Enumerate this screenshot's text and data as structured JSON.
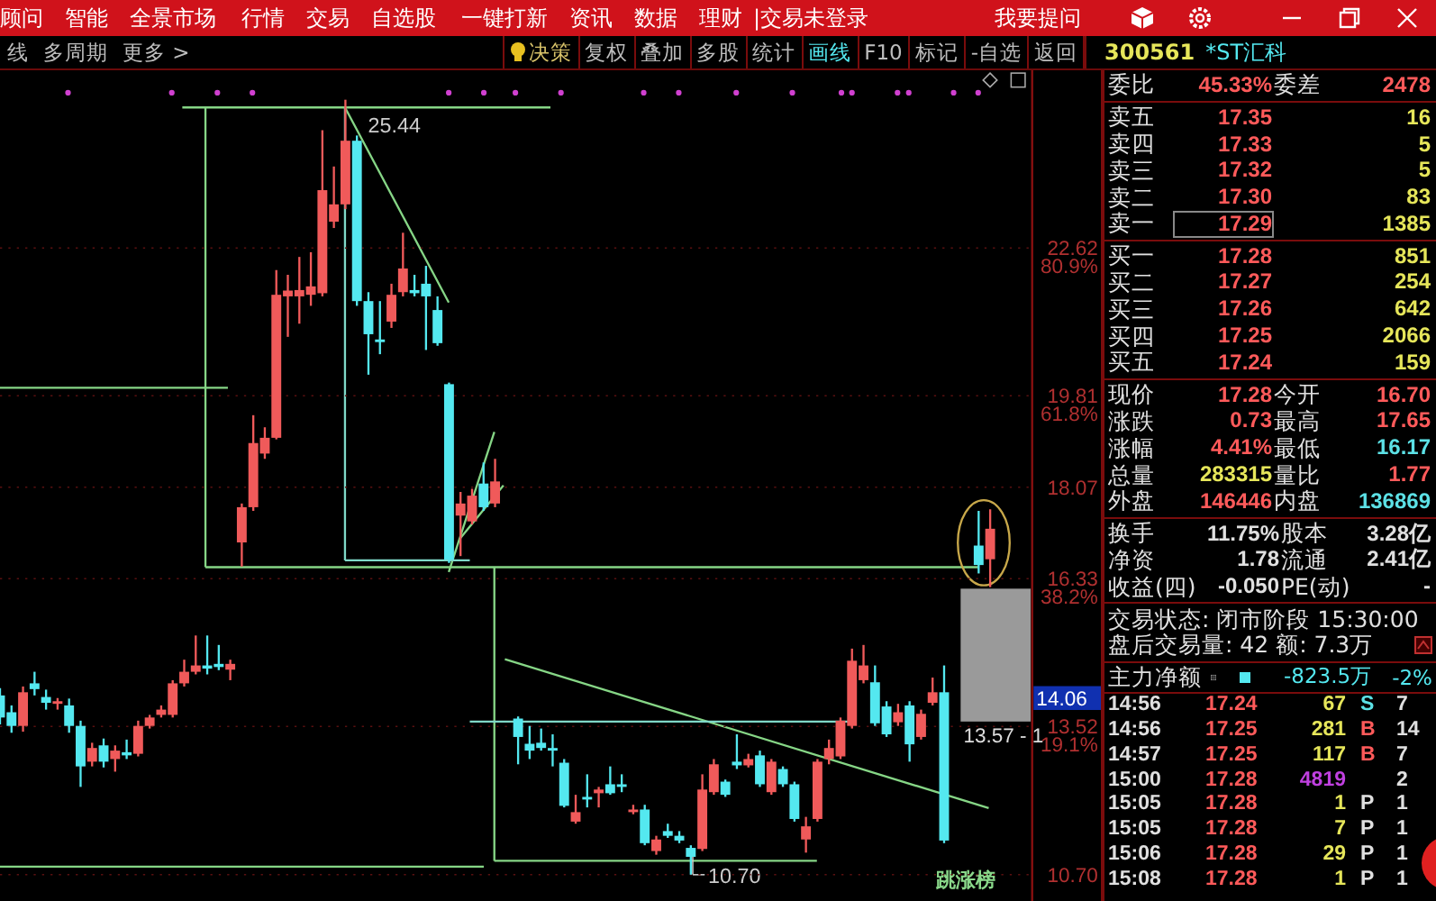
{
  "menu_bar": {
    "items": [
      "顾问",
      "智能",
      "全景市场",
      "行情",
      "交易",
      "自选股",
      "一键打新",
      "资讯",
      "数据",
      "理财"
    ],
    "login_status": "|交易未登录",
    "ask_link": "我要提问"
  },
  "toolbar": {
    "left": [
      "线",
      "多周期",
      "更多 >"
    ],
    "right": [
      {
        "label": "决策",
        "kind": "decision",
        "selected": false
      },
      {
        "label": "复权",
        "kind": "plain",
        "selected": false
      },
      {
        "label": "叠加",
        "kind": "plain",
        "selected": false
      },
      {
        "label": "多股",
        "kind": "plain",
        "selected": false
      },
      {
        "label": "统计",
        "kind": "plain",
        "selected": false
      },
      {
        "label": "画线",
        "kind": "plain",
        "selected": true
      },
      {
        "label": "F10",
        "kind": "plain",
        "selected": false
      },
      {
        "label": "标记",
        "kind": "plain",
        "selected": false
      },
      {
        "label": "-自选",
        "kind": "plain",
        "selected": false
      },
      {
        "label": "返回",
        "kind": "plain",
        "selected": false
      }
    ]
  },
  "stock": {
    "code": "300561",
    "name": "*ST汇科"
  },
  "chart": {
    "badge": "跳涨榜",
    "fib_ratios": [
      "80.9%",
      "61.8%",
      "38.2%",
      "19.1%"
    ],
    "low_label": "10.70",
    "chart_data": {
      "type": "candlestick",
      "categories": [
        null,
        null,
        null,
        null,
        null,
        null,
        null,
        null,
        null,
        null,
        null,
        null,
        null,
        null,
        null,
        null,
        null,
        null,
        null,
        null,
        null,
        null,
        null,
        null,
        null,
        null,
        null,
        null,
        null,
        null,
        null,
        null,
        null,
        null,
        null,
        null,
        null,
        null,
        null,
        null,
        null,
        null,
        null,
        null,
        null,
        null,
        null,
        null,
        null,
        null,
        null,
        null,
        null,
        null,
        null,
        null,
        null,
        null,
        null,
        null,
        null,
        null,
        null,
        null,
        null,
        null,
        null,
        null,
        null,
        null,
        null,
        null,
        null,
        null,
        null,
        null,
        null,
        null,
        null,
        null,
        null,
        null,
        null,
        null,
        null,
        null,
        null
      ],
      "ohlc": [
        [
          14.11,
          14.25,
          13.56,
          13.69
        ],
        [
          13.79,
          13.92,
          13.4,
          13.53
        ],
        [
          13.53,
          14.28,
          13.42,
          14.17
        ],
        [
          14.34,
          14.56,
          14.11,
          14.23
        ],
        [
          14.08,
          14.22,
          13.84,
          13.97
        ],
        [
          13.95,
          14.06,
          13.84,
          14.0
        ],
        [
          13.92,
          14.05,
          13.4,
          13.53
        ],
        [
          13.53,
          13.63,
          12.37,
          12.76
        ],
        [
          12.85,
          13.21,
          12.76,
          13.11
        ],
        [
          13.16,
          13.29,
          12.74,
          12.85
        ],
        [
          12.9,
          13.16,
          12.66,
          13.06
        ],
        [
          13.03,
          13.27,
          12.9,
          12.97
        ],
        [
          13.0,
          13.63,
          12.95,
          13.53
        ],
        [
          13.53,
          13.74,
          13.48,
          13.69
        ],
        [
          13.74,
          13.92,
          13.69,
          13.84
        ],
        [
          13.74,
          14.4,
          13.69,
          14.34
        ],
        [
          14.34,
          14.79,
          14.28,
          14.56
        ],
        [
          14.56,
          15.25,
          14.51,
          14.68
        ],
        [
          14.68,
          15.25,
          14.51,
          14.62
        ],
        [
          14.71,
          15.07,
          14.59,
          14.65
        ],
        [
          14.6,
          14.79,
          14.4,
          14.71
        ],
        [
          17.02,
          17.76,
          16.56,
          17.69
        ],
        [
          17.69,
          19.44,
          17.62,
          18.91
        ],
        [
          18.71,
          19.21,
          18.61,
          19.01
        ],
        [
          19.01,
          22.2,
          18.98,
          21.73
        ],
        [
          21.7,
          22.11,
          20.93,
          21.81
        ],
        [
          21.7,
          22.45,
          21.18,
          21.82
        ],
        [
          21.73,
          22.54,
          21.52,
          21.89
        ],
        [
          21.76,
          24.86,
          21.7,
          23.72
        ],
        [
          23.12,
          24.17,
          23.0,
          23.45
        ],
        [
          23.45,
          25.44,
          23.36,
          24.66
        ],
        [
          24.66,
          24.76,
          21.52,
          21.61
        ],
        [
          21.61,
          21.78,
          20.21,
          20.98
        ],
        [
          20.88,
          21.61,
          20.6,
          20.83
        ],
        [
          21.22,
          21.94,
          21.1,
          21.73
        ],
        [
          21.78,
          22.91,
          21.7,
          22.23
        ],
        [
          21.82,
          22.11,
          21.7,
          21.76
        ],
        [
          21.94,
          22.28,
          20.68,
          21.7
        ],
        [
          21.44,
          21.7,
          20.76,
          20.81
        ],
        [
          20.03,
          20.06,
          16.63,
          16.69
        ],
        [
          17.53,
          17.98,
          16.76,
          17.76
        ],
        [
          17.42,
          18.04,
          17.36,
          17.91
        ],
        [
          18.14,
          18.54,
          17.62,
          17.69
        ],
        [
          17.76,
          18.61,
          17.69,
          18.18
        ],
        null,
        [
          13.67,
          13.71,
          12.8,
          13.32
        ],
        [
          13.19,
          13.53,
          12.9,
          13.06
        ],
        [
          13.21,
          13.48,
          13.06,
          13.11
        ],
        [
          13.11,
          13.37,
          12.76,
          13.06
        ],
        [
          12.83,
          12.9,
          11.98,
          12.01
        ],
        [
          11.71,
          12.22,
          11.67,
          11.89
        ],
        [
          12.18,
          12.61,
          11.98,
          12.13
        ],
        [
          12.25,
          12.37,
          11.98,
          12.32
        ],
        [
          12.42,
          12.76,
          12.22,
          12.25
        ],
        [
          12.42,
          12.61,
          12.27,
          12.37
        ],
        [
          11.89,
          12.03,
          11.85,
          11.94
        ],
        [
          11.94,
          12.03,
          11.26,
          11.3
        ],
        [
          11.15,
          11.44,
          11.08,
          11.37
        ],
        [
          11.53,
          11.67,
          11.4,
          11.44
        ],
        [
          11.44,
          11.53,
          11.3,
          11.35
        ],
        [
          11.21,
          11.26,
          10.7,
          11.04
        ],
        [
          11.19,
          12.61,
          11.15,
          12.32
        ],
        [
          12.27,
          12.9,
          12.22,
          12.8
        ],
        [
          12.47,
          12.51,
          12.18,
          12.22
        ],
        [
          12.85,
          13.37,
          12.71,
          12.78
        ],
        [
          12.78,
          13.0,
          12.74,
          12.9
        ],
        [
          12.97,
          13.06,
          12.37,
          12.42
        ],
        [
          12.27,
          12.9,
          12.22,
          12.85
        ],
        [
          12.71,
          12.76,
          12.37,
          12.42
        ],
        [
          12.42,
          12.47,
          11.71,
          11.76
        ],
        [
          11.37,
          11.8,
          11.12,
          11.62
        ],
        [
          11.76,
          12.9,
          11.71,
          12.85
        ],
        [
          12.9,
          13.27,
          12.8,
          13.11
        ],
        [
          12.95,
          13.69,
          12.9,
          13.63
        ],
        [
          13.53,
          15.0,
          13.48,
          14.77
        ],
        [
          14.4,
          15.07,
          14.34,
          14.68
        ],
        [
          14.36,
          14.68,
          13.53,
          13.58
        ],
        [
          13.9,
          14.0,
          13.32,
          13.37
        ],
        [
          13.6,
          13.95,
          13.53,
          13.79
        ],
        [
          13.92,
          14.0,
          12.85,
          13.18
        ],
        [
          13.32,
          13.84,
          13.27,
          13.76
        ],
        [
          13.97,
          14.45,
          13.92,
          14.17
        ],
        [
          14.17,
          14.68,
          11.3,
          11.35
        ],
        null,
        null,
        [
          16.96,
          17.62,
          16.43,
          16.59
        ],
        [
          16.7,
          17.65,
          16.17,
          17.28
        ]
      ],
      "ylim": [
        10.2,
        26.0
      ],
      "grid": true,
      "yticks": [
        {
          "value": 22.62,
          "label": "22.62"
        },
        {
          "value": 19.81,
          "label": "19.81"
        },
        {
          "value": 18.07,
          "label": "18.07"
        },
        {
          "value": 16.33,
          "label": "16.33"
        },
        {
          "value": 13.52,
          "label": "13.52"
        },
        {
          "value": 10.7,
          "label": "10.70"
        }
      ],
      "annotations": [
        "25.44",
        "14.06",
        "13.57 - 1"
      ]
    }
  },
  "order_book": {
    "ratio_label": "委比",
    "ratio": "45.33%",
    "diff_label": "委差",
    "diff": "2478",
    "asks": [
      {
        "label": "卖五",
        "price": "17.35",
        "volume": "16",
        "selected": false
      },
      {
        "label": "卖四",
        "price": "17.33",
        "volume": "5",
        "selected": false
      },
      {
        "label": "卖三",
        "price": "17.32",
        "volume": "5",
        "selected": false
      },
      {
        "label": "卖二",
        "price": "17.30",
        "volume": "83",
        "selected": false
      },
      {
        "label": "卖一",
        "price": "17.29",
        "volume": "1385",
        "selected": true
      }
    ],
    "bids": [
      {
        "label": "买一",
        "price": "17.28",
        "volume": "851",
        "selected": false
      },
      {
        "label": "买二",
        "price": "17.27",
        "volume": "254",
        "selected": false
      },
      {
        "label": "买三",
        "price": "17.26",
        "volume": "642",
        "selected": false
      },
      {
        "label": "买四",
        "price": "17.25",
        "volume": "2066",
        "selected": false
      },
      {
        "label": "买五",
        "price": "17.24",
        "volume": "159",
        "selected": false
      }
    ]
  },
  "quote": [
    {
      "label": "现价",
      "value": "17.28",
      "color": "#ff5a5a"
    },
    {
      "label": "今开",
      "value": "16.70",
      "color": "#ff5a5a"
    },
    {
      "label": "涨跌",
      "value": "0.73",
      "color": "#ff5a5a"
    },
    {
      "label": "最高",
      "value": "17.65",
      "color": "#ff5a5a"
    },
    {
      "label": "涨幅",
      "value": "4.41%",
      "color": "#ff5a5a"
    },
    {
      "label": "最低",
      "value": "16.17",
      "color": "#5ce1e6"
    },
    {
      "label": "总量",
      "value": "283315",
      "color": "#e6e65a"
    },
    {
      "label": "量比",
      "value": "1.77",
      "color": "#ff5a5a"
    },
    {
      "label": "外盘",
      "value": "146446",
      "color": "#ff5a5a"
    },
    {
      "label": "内盘",
      "value": "136869",
      "color": "#5ce1e6"
    }
  ],
  "fundamentals": [
    {
      "label": "换手",
      "value": "11.75%"
    },
    {
      "label": "股本",
      "value": "3.28亿"
    },
    {
      "label": "净资",
      "value": "1.78"
    },
    {
      "label": "流通",
      "value": "2.41亿"
    },
    {
      "label": "收益(四)",
      "value": "-0.050"
    },
    {
      "label": "PE(动)",
      "value": "-"
    }
  ],
  "status": "交易状态: 闭市阶段 15:30:00",
  "after_hours": "盘后交易量: 42  额: 7.3万",
  "main_force": {
    "label": "主力净额",
    "value": "-823.5万",
    "percent": "-2%"
  },
  "ticks": [
    {
      "time": "14:56",
      "price": "17.24",
      "volume": {
        "text": "67",
        "color": "#e6e65a"
      },
      "flag": {
        "text": "S",
        "color": "#5ce1e6"
      },
      "extra": "7"
    },
    {
      "time": "14:56",
      "price": "17.25",
      "volume": {
        "text": "281",
        "color": "#e6e65a"
      },
      "flag": {
        "text": "B",
        "color": "#ff5a5a"
      },
      "extra": "14"
    },
    {
      "time": "14:57",
      "price": "17.25",
      "volume": {
        "text": "117",
        "color": "#e6e65a"
      },
      "flag": {
        "text": "B",
        "color": "#ff5a5a"
      },
      "extra": "7"
    },
    {
      "time": "15:00",
      "price": "17.28",
      "volume": {
        "text": "4819",
        "color": "#c040e0"
      },
      "extra": "2"
    },
    {
      "time": "15:05",
      "price": "17.28",
      "volume": {
        "text": "1",
        "color": "#e6e65a"
      },
      "flag": {
        "text": "P",
        "color": "#e0e0e0"
      },
      "extra": "1"
    },
    {
      "time": "15:05",
      "price": "17.28",
      "volume": {
        "text": "7",
        "color": "#e6e65a"
      },
      "flag": {
        "text": "P",
        "color": "#e0e0e0"
      },
      "extra": "1"
    },
    {
      "time": "15:06",
      "price": "17.28",
      "volume": {
        "text": "29",
        "color": "#e6e65a"
      },
      "flag": {
        "text": "P",
        "color": "#e0e0e0"
      },
      "extra": "1"
    },
    {
      "time": "15:08",
      "price": "17.28",
      "volume": {
        "text": "1",
        "color": "#e6e65a"
      },
      "flag": {
        "text": "P",
        "color": "#e0e0e0"
      },
      "extra": "1"
    }
  ]
}
